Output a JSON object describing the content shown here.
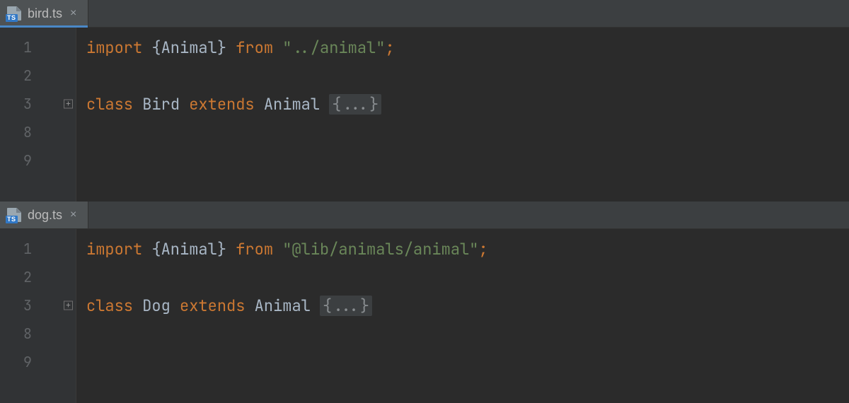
{
  "panes": [
    {
      "tab": {
        "filename": "bird.ts",
        "icon_label": "TS",
        "active": true
      },
      "line_numbers": [
        "1",
        "2",
        "3",
        "8",
        "9"
      ],
      "code": {
        "import_kw": "import",
        "import_braces_open": "{",
        "import_identifier": "Animal",
        "import_braces_close": "}",
        "from_kw": "from",
        "import_path": "\"../animal\"",
        "semicolon": ";",
        "class_kw": "class",
        "class_name": "Bird",
        "extends_kw": "extends",
        "superclass": "Animal",
        "folded_body": "{...}"
      }
    },
    {
      "tab": {
        "filename": "dog.ts",
        "icon_label": "TS",
        "active": false
      },
      "line_numbers": [
        "1",
        "2",
        "3",
        "8",
        "9"
      ],
      "code": {
        "import_kw": "import",
        "import_braces_open": "{",
        "import_identifier": "Animal",
        "import_braces_close": "}",
        "from_kw": "from",
        "import_path": "\"@lib/animals/animal\"",
        "semicolon": ";",
        "class_kw": "class",
        "class_name": "Dog",
        "extends_kw": "extends",
        "superclass": "Animal",
        "folded_body": "{...}"
      }
    }
  ],
  "glyphs": {
    "close": "×",
    "fold_expand": "+"
  }
}
